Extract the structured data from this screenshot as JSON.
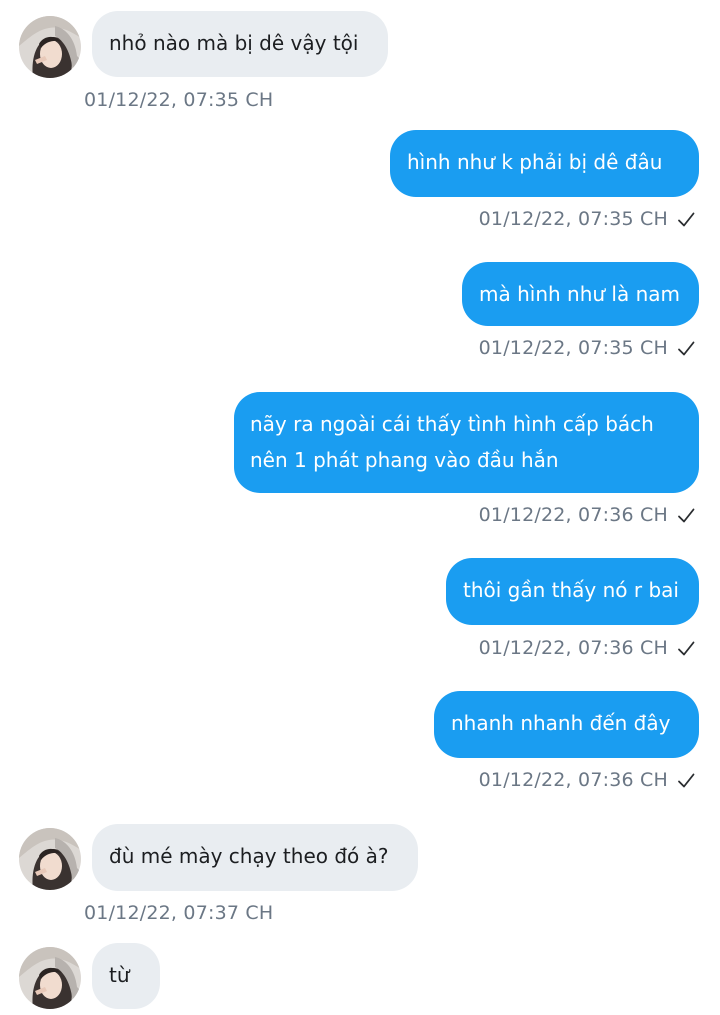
{
  "colors": {
    "incoming_bubble": "#e9edf1",
    "outgoing_bubble": "#1a9df1",
    "timestamp_text": "#6b7785"
  },
  "messages": [
    {
      "direction": "incoming",
      "text": "nhỏ nào mà bị dê vậy tội",
      "time": "01/12/22,  07:35 CH"
    },
    {
      "direction": "outgoing",
      "text": "hình như k phải bị dê đâu",
      "time": "01/12/22,  07:35 CH"
    },
    {
      "direction": "outgoing",
      "text": "mà hình như là nam",
      "time": "01/12/22,  07:35 CH"
    },
    {
      "direction": "outgoing",
      "lines": [
        "nãy ra ngoài cái thấy tình hình cấp bách",
        "nên 1 phát phang vào đầu hắn"
      ],
      "time": "01/12/22,  07:36 CH"
    },
    {
      "direction": "outgoing",
      "text": "thôi gần thấy nó r bai",
      "time": "01/12/22,  07:36 CH"
    },
    {
      "direction": "outgoing",
      "text": "nhanh nhanh đến đây",
      "time": "01/12/22,  07:36 CH"
    },
    {
      "direction": "incoming",
      "text": "đù mé mày chạy theo đó à?",
      "time": "01/12/22,  07:37 CH"
    },
    {
      "direction": "incoming",
      "text": "từ"
    }
  ]
}
